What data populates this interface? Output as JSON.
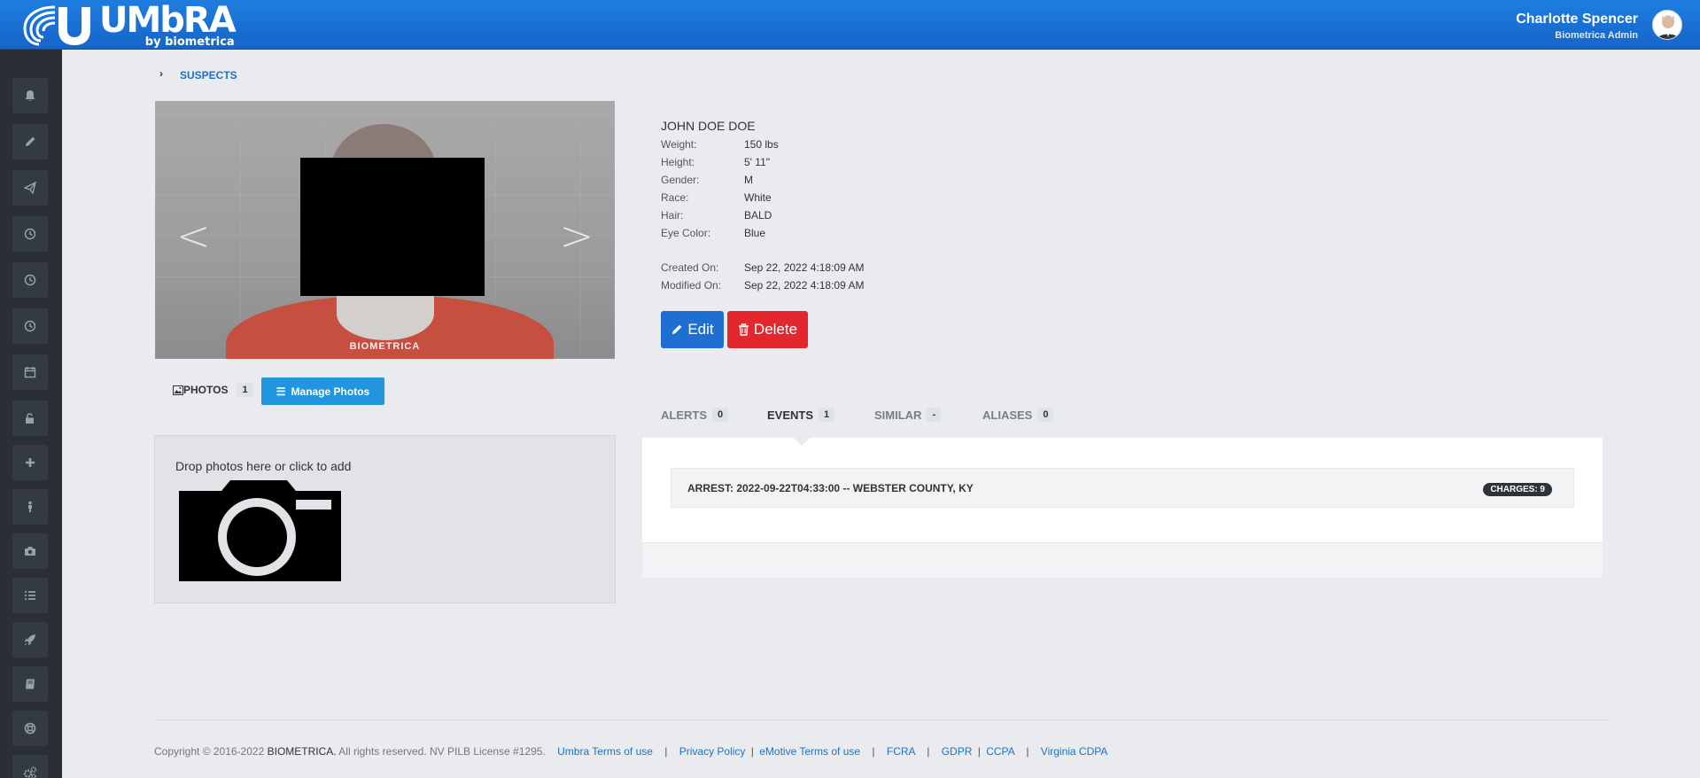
{
  "header": {
    "logo_title": "UMbRA",
    "logo_sub": "by biometrica",
    "user_name": "Charlotte Spencer",
    "user_role": "Biometrica Admin"
  },
  "sidebar": {
    "icons": [
      "bell-icon",
      "pencil-icon",
      "paper-plane-icon",
      "clock-icon",
      "clock-icon",
      "clock-icon",
      "calendar-icon",
      "unlock-icon",
      "plus-icon",
      "person-icon",
      "camera-icon",
      "list-icon",
      "rocket-icon",
      "book-icon",
      "lifebuoy-icon",
      "gears-icon"
    ]
  },
  "breadcrumb": {
    "current": "SUSPECTS"
  },
  "photo": {
    "watermark": "BIOMETRICA"
  },
  "photos_tab": {
    "label": "PHOTOS",
    "count": "1",
    "manage_label": "Manage Photos"
  },
  "dropzone": {
    "text": "Drop photos here or click to add"
  },
  "suspect": {
    "name": "JOHN DOE DOE",
    "details": [
      {
        "label": "Weight:",
        "value": "150 lbs"
      },
      {
        "label": "Height:",
        "value": "5' 11\""
      },
      {
        "label": "Gender:",
        "value": "M"
      },
      {
        "label": "Race:",
        "value": "White"
      },
      {
        "label": "Hair:",
        "value": "BALD"
      },
      {
        "label": "Eye Color:",
        "value": "Blue"
      }
    ],
    "created_label": "Created On:",
    "created_value": "Sep 22, 2022 4:18:09 AM",
    "modified_label": "Modified On:",
    "modified_value": "Sep 22, 2022 4:18:09 AM"
  },
  "actions": {
    "edit_label": "Edit",
    "delete_label": "Delete"
  },
  "tabs": [
    {
      "label": "ALERTS",
      "count": "0"
    },
    {
      "label": "EVENTS",
      "count": "1"
    },
    {
      "label": "SIMILAR",
      "count": "-"
    },
    {
      "label": "ALIASES",
      "count": "0"
    }
  ],
  "events": [
    {
      "text": "ARREST: 2022-09-22T04:33:00 -- WEBSTER COUNTY, KY",
      "charges": "CHARGES: 9"
    }
  ],
  "footer": {
    "copyright": "Copyright © 2016-2022",
    "brand": "BIOMETRICA.",
    "rights": "All rights reserved. NV PILB License #1295.",
    "links": [
      "Umbra Terms of use",
      "Privacy Policy",
      "eMotive Terms of use",
      "FCRA",
      "GDPR",
      "CCPA",
      "Virginia CDPA"
    ]
  },
  "colors": {
    "header_blue": "#1f7de0",
    "sidebar": "#2a2f36",
    "edit_blue": "#1e6fd1",
    "delete_red": "#e2282e",
    "manage_blue": "#2196de",
    "link_blue": "#1a73c8"
  }
}
